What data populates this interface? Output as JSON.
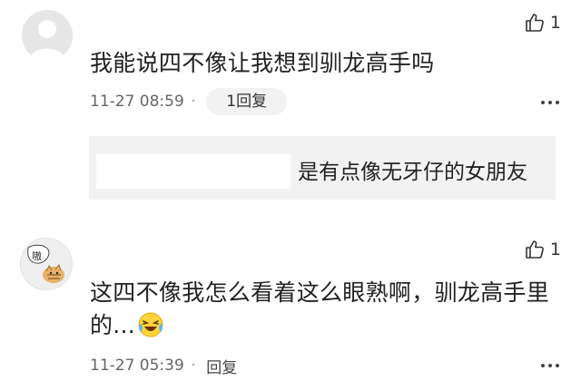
{
  "comments": [
    {
      "likes": "1",
      "text": "我能说四不像让我想到驯龙高手吗",
      "timestamp": "11-27 08:59",
      "separator": "·",
      "reply_button": "1回复",
      "replies": [
        {
          "text": "是有点像无牙仔的女朋友"
        }
      ]
    },
    {
      "likes": "1",
      "text": "这四不像我怎么看着这么眼熟啊，驯龙高手里的...",
      "timestamp": "11-27 05:39",
      "separator": "·",
      "reply_button": "回复"
    }
  ],
  "icons": {
    "like": "thumbs-up-icon",
    "more": "more-dots-icon",
    "emoji": "laughing-crying-emoji"
  },
  "avatar_text": "嗷"
}
